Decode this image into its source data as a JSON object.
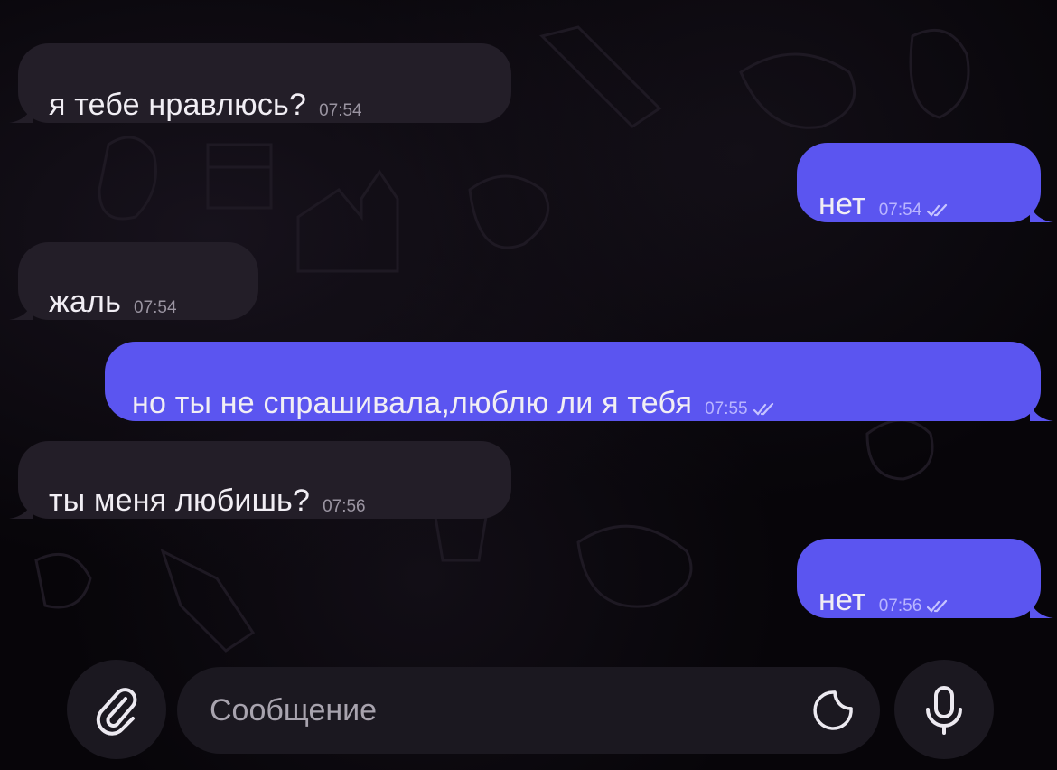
{
  "chat": {
    "messages": [
      {
        "direction": "in",
        "text": "я тебе нравлюсь?",
        "time": "07:54"
      },
      {
        "direction": "out",
        "text": "нет",
        "time": "07:54",
        "status": "read"
      },
      {
        "direction": "in",
        "text": "жаль",
        "time": "07:54"
      },
      {
        "direction": "out",
        "text": "но ты не спрашивала,люблю ли я тебя",
        "time": "07:55",
        "status": "read"
      },
      {
        "direction": "in",
        "text": "ты меня любишь?",
        "time": "07:56"
      },
      {
        "direction": "out",
        "text": "нет",
        "time": "07:56",
        "status": "read"
      }
    ]
  },
  "composer": {
    "placeholder": "Сообщение",
    "attach_icon": "paperclip-icon",
    "sticker_icon": "sticker-icon",
    "mic_icon": "microphone-icon"
  },
  "colors": {
    "background": "#070509",
    "incoming_bubble": "#231e28",
    "outgoing_bubble": "#5b55f0",
    "composer": "#1b1820"
  }
}
